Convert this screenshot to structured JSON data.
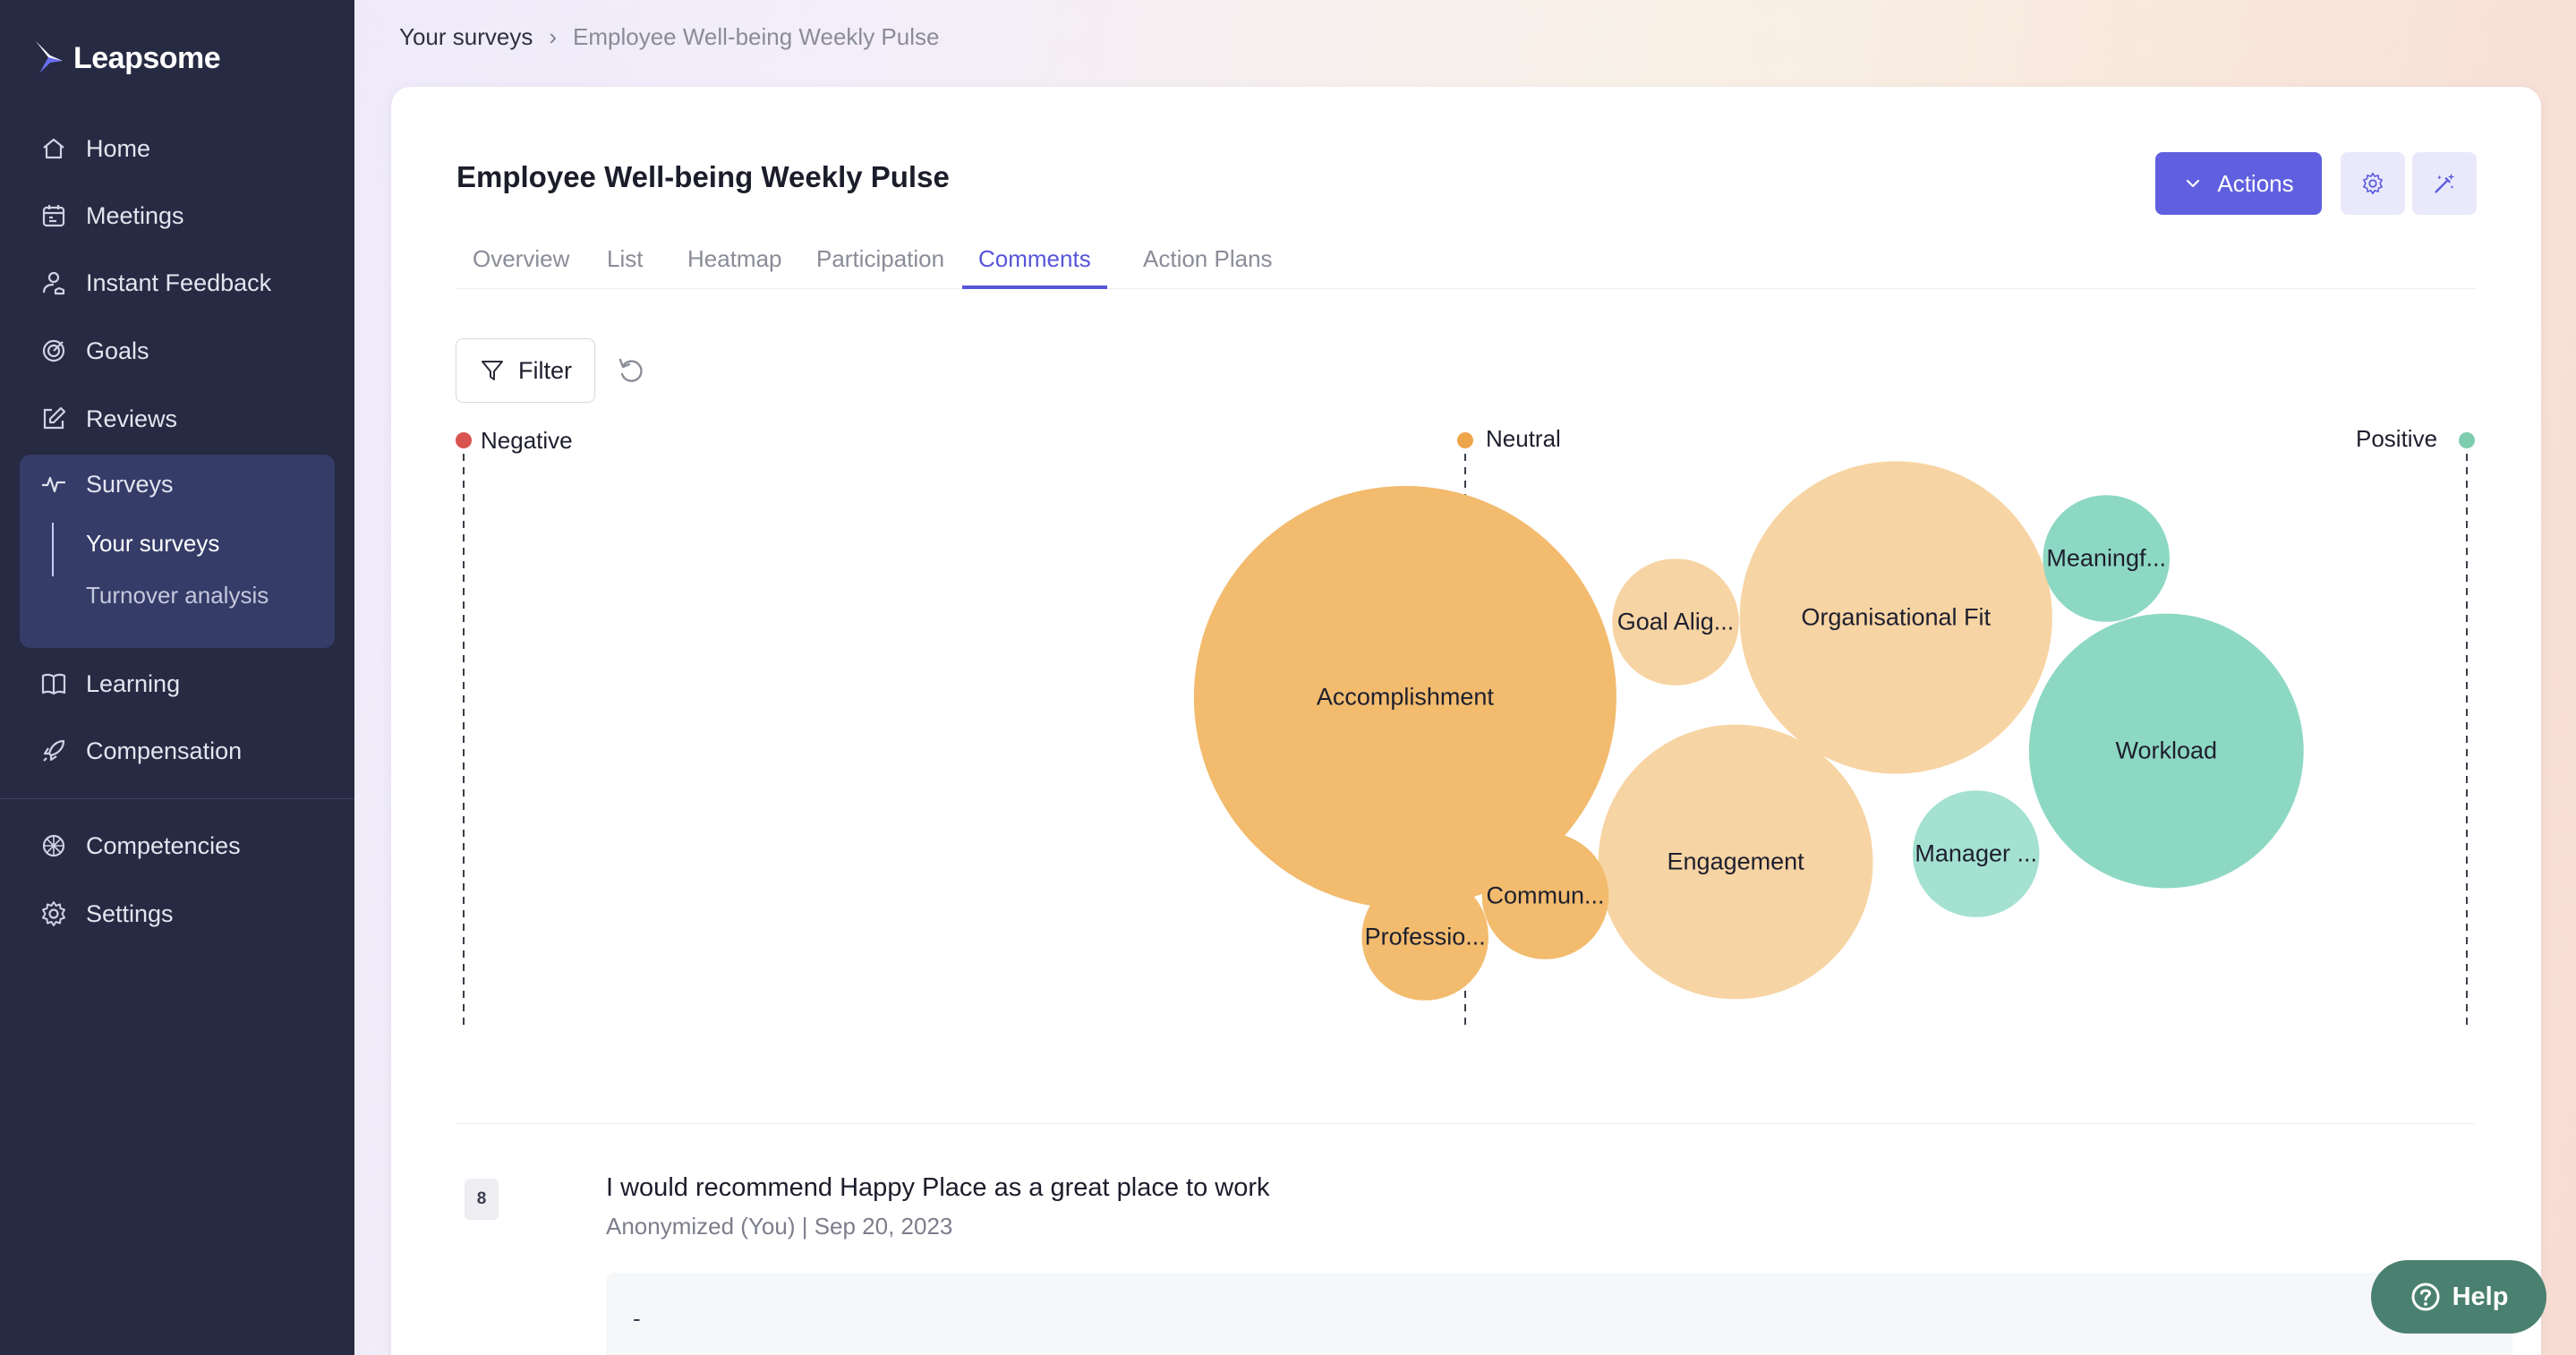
{
  "app": {
    "brand": "Leapsome"
  },
  "sidebar": {
    "items": [
      {
        "label": "Home",
        "icon": "home-icon"
      },
      {
        "label": "Meetings",
        "icon": "calendar-icon"
      },
      {
        "label": "Instant Feedback",
        "icon": "feedback-icon"
      },
      {
        "label": "Goals",
        "icon": "target-icon"
      },
      {
        "label": "Reviews",
        "icon": "edit-icon"
      },
      {
        "label": "Surveys",
        "icon": "pulse-icon"
      },
      {
        "label": "Learning",
        "icon": "book-icon"
      },
      {
        "label": "Compensation",
        "icon": "rocket-icon"
      },
      {
        "label": "Competencies",
        "icon": "competencies-icon"
      },
      {
        "label": "Settings",
        "icon": "gear-icon"
      }
    ],
    "surveys_sub": [
      {
        "label": "Your surveys"
      },
      {
        "label": "Turnover analysis"
      }
    ]
  },
  "breadcrumb": {
    "parent": "Your surveys",
    "separator": "›",
    "current": "Employee Well-being Weekly Pulse"
  },
  "page": {
    "title": "Employee Well-being Weekly Pulse",
    "actions_label": "Actions",
    "tabs": [
      {
        "label": "Overview"
      },
      {
        "label": "List"
      },
      {
        "label": "Heatmap"
      },
      {
        "label": "Participation"
      },
      {
        "label": "Comments"
      },
      {
        "label": "Action Plans"
      }
    ],
    "active_tab": "Comments",
    "filter_label": "Filter"
  },
  "colors": {
    "accent": "#5f5fdf",
    "negative": "#d9534f",
    "neutral": "#eea54a",
    "positive": "#7fcdb1",
    "sidebar_bg": "#262a42",
    "help_bg": "#4a8070"
  },
  "chart_data": {
    "type": "bubble",
    "x_axis": {
      "labels": [
        "Negative",
        "Neutral",
        "Positive"
      ]
    },
    "bubbles": [
      {
        "label": "Accomplishment",
        "sentiment": -0.06,
        "size": 1.0,
        "color": "#f2bb6e"
      },
      {
        "label": "Goal Alig...",
        "sentiment": 0.21,
        "size": 0.3,
        "color": "#f7d4a3"
      },
      {
        "label": "Organisational Fit",
        "sentiment": 0.43,
        "size": 0.74,
        "color": "#f7d4a3"
      },
      {
        "label": "Meaningf...",
        "sentiment": 0.64,
        "size": 0.3,
        "color": "#8dd8c3"
      },
      {
        "label": "Workload",
        "sentiment": 0.7,
        "size": 0.65,
        "color": "#8dd8c3"
      },
      {
        "label": "Engagement",
        "sentiment": 0.27,
        "size": 0.65,
        "color": "#f7d4a3"
      },
      {
        "label": "Manager ...",
        "sentiment": 0.51,
        "size": 0.3,
        "color": "#a4e1d1"
      },
      {
        "label": "Commun...",
        "sentiment": 0.08,
        "size": 0.3,
        "color": "#f2bb6e"
      },
      {
        "label": "Professio...",
        "sentiment": -0.04,
        "size": 0.3,
        "color": "#f2bb6e"
      }
    ]
  },
  "comment": {
    "score": "8",
    "question": "I would recommend Happy Place as a great place to work",
    "meta": "Anonymized (You)  |  Sep 20, 2023",
    "text": "-"
  },
  "help": {
    "label": "Help"
  }
}
